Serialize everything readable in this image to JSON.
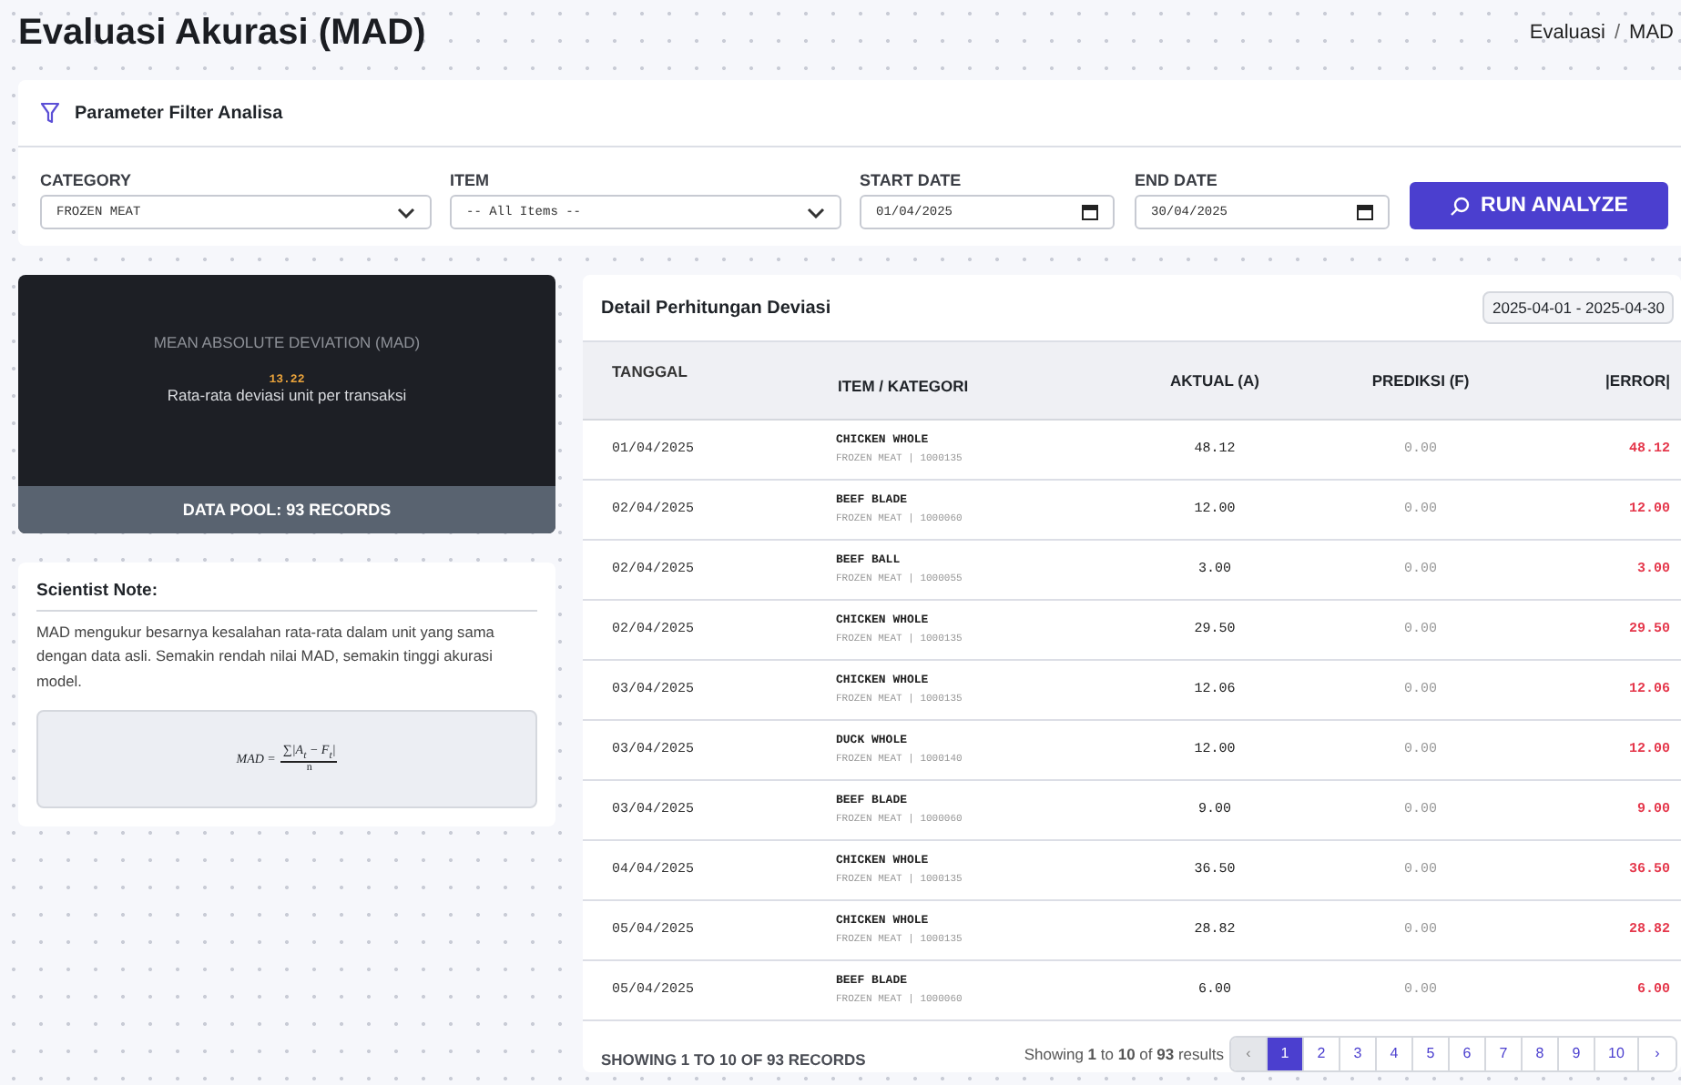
{
  "header": {
    "title": "Evaluasi Akurasi (MAD)",
    "breadcrumb": {
      "items": [
        "Evaluasi",
        "MAD"
      ],
      "separator": "/"
    }
  },
  "filter": {
    "title": "Parameter Filter Analisa",
    "fields": [
      {
        "kind": "select",
        "label": "CATEGORY",
        "value": "FROZEN MEAT"
      },
      {
        "kind": "select",
        "label": "ITEM",
        "value": "-- All Items --"
      },
      {
        "kind": "date",
        "label": "START DATE",
        "value": "01/04/2025"
      },
      {
        "kind": "date",
        "label": "END DATE",
        "value": "30/04/2025"
      }
    ],
    "button": "RUN ANALYZE"
  },
  "mad_card": {
    "title": "MEAN ABSOLUTE DEVIATION (MAD)",
    "value": "13.22",
    "caption": "Rata-rata deviasi unit per transaksi",
    "footer": "DATA POOL: 93 RECORDS"
  },
  "note": {
    "title": "Scientist Note:",
    "text": "MAD mengukur besarnya kesalahan rata-rata dalam unit yang sama dengan data asli. Semakin rendah nilai MAD, semakin tinggi akurasi model.",
    "formula": {
      "lhs": "MAD =",
      "numerator": "∑|A$_{t}$ − F$_{t}$|",
      "denominator": "n"
    }
  },
  "table": {
    "title": "Detail Perhitungan Deviasi",
    "range": "2025-04-01 - 2025-04-30",
    "columns": [
      "TANGGAL",
      "ITEM / KATEGORI",
      "AKTUAL (A)",
      "PREDIKSI (F)",
      "|ERROR|"
    ],
    "rows": [
      {
        "date": "01/04/2025",
        "item": "CHICKEN WHOLE",
        "meta": "FROZEN MEAT | 1000135",
        "actual": "48.12",
        "forecast": "0.00",
        "error": "48.12"
      },
      {
        "date": "02/04/2025",
        "item": "BEEF BLADE",
        "meta": "FROZEN MEAT | 1000060",
        "actual": "12.00",
        "forecast": "0.00",
        "error": "12.00"
      },
      {
        "date": "02/04/2025",
        "item": "BEEF BALL",
        "meta": "FROZEN MEAT | 1000055",
        "actual": "3.00",
        "forecast": "0.00",
        "error": "3.00"
      },
      {
        "date": "02/04/2025",
        "item": "CHICKEN WHOLE",
        "meta": "FROZEN MEAT | 1000135",
        "actual": "29.50",
        "forecast": "0.00",
        "error": "29.50"
      },
      {
        "date": "03/04/2025",
        "item": "CHICKEN WHOLE",
        "meta": "FROZEN MEAT | 1000135",
        "actual": "12.06",
        "forecast": "0.00",
        "error": "12.06"
      },
      {
        "date": "03/04/2025",
        "item": "DUCK WHOLE",
        "meta": "FROZEN MEAT | 1000140",
        "actual": "12.00",
        "forecast": "0.00",
        "error": "12.00"
      },
      {
        "date": "03/04/2025",
        "item": "BEEF BLADE",
        "meta": "FROZEN MEAT | 1000060",
        "actual": "9.00",
        "forecast": "0.00",
        "error": "9.00"
      },
      {
        "date": "04/04/2025",
        "item": "CHICKEN WHOLE",
        "meta": "FROZEN MEAT | 1000135",
        "actual": "36.50",
        "forecast": "0.00",
        "error": "36.50"
      },
      {
        "date": "05/04/2025",
        "item": "CHICKEN WHOLE",
        "meta": "FROZEN MEAT | 1000135",
        "actual": "28.82",
        "forecast": "0.00",
        "error": "28.82"
      },
      {
        "date": "05/04/2025",
        "item": "BEEF BLADE",
        "meta": "FROZEN MEAT | 1000060",
        "actual": "6.00",
        "forecast": "0.00",
        "error": "6.00"
      }
    ],
    "footer": "SHOWING 1 TO 10 OF 93 RECORDS",
    "results": "Showing **1** to **10** of **93** results",
    "pages": [
      {
        "label": "‹",
        "kind": "prev",
        "selected": false,
        "disabled": true
      },
      {
        "label": "1",
        "kind": "page",
        "selected": true,
        "disabled": false
      },
      {
        "label": "2",
        "kind": "page",
        "selected": false,
        "disabled": false
      },
      {
        "label": "3",
        "kind": "page",
        "selected": false,
        "disabled": false
      },
      {
        "label": "4",
        "kind": "page",
        "selected": false,
        "disabled": false
      },
      {
        "label": "5",
        "kind": "page",
        "selected": false,
        "disabled": false
      },
      {
        "label": "6",
        "kind": "page",
        "selected": false,
        "disabled": false
      },
      {
        "label": "7",
        "kind": "page",
        "selected": false,
        "disabled": false
      },
      {
        "label": "8",
        "kind": "page",
        "selected": false,
        "disabled": false
      },
      {
        "label": "9",
        "kind": "page",
        "selected": false,
        "disabled": false
      },
      {
        "label": "10",
        "kind": "page",
        "selected": false,
        "disabled": false
      },
      {
        "label": "›",
        "kind": "next",
        "selected": false,
        "disabled": false
      }
    ]
  }
}
